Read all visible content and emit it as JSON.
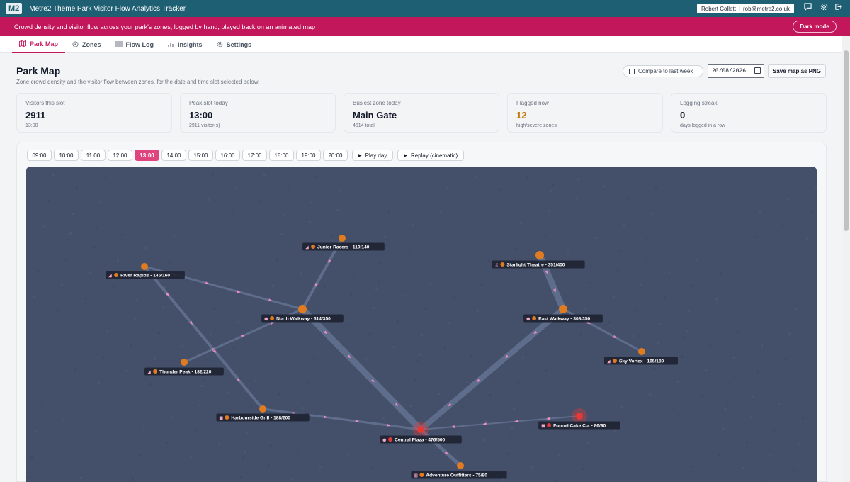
{
  "titlebar": {
    "logo": "M2",
    "title": "Metre2 Theme Park Visitor Flow Analytics Tracker",
    "user_name": "Robert Collett",
    "user_email": "rob@metre2.co.uk"
  },
  "banner": {
    "text": "Crowd density and visitor flow across your park's zones, logged by hand, played back on an animated map",
    "dark_mode_label": "Dark mode"
  },
  "tabs": [
    {
      "label": "Park Map",
      "icon": "map-icon",
      "active": true
    },
    {
      "label": "Zones",
      "icon": "pin-icon",
      "active": false
    },
    {
      "label": "Flow Log",
      "icon": "list-icon",
      "active": false
    },
    {
      "label": "Insights",
      "icon": "bar-chart-icon",
      "active": false
    },
    {
      "label": "Settings",
      "icon": "gear-icon",
      "active": false
    }
  ],
  "header": {
    "title": "Park Map",
    "subtitle": "Zone crowd density and the visitor flow between zones, for the date and time slot selected below.",
    "compare_label": "Compare to last week",
    "date_value": "20/08/2026",
    "save_label": "Save map as PNG"
  },
  "stats": [
    {
      "label": "Visitors this slot",
      "value": "2911",
      "sub": "13:00",
      "warn": false
    },
    {
      "label": "Peak slot today",
      "value": "13:00",
      "sub": "2911 visitor(s)",
      "warn": false
    },
    {
      "label": "Busiest zone today",
      "value": "Main Gate",
      "sub": "4514 total",
      "warn": false
    },
    {
      "label": "Flagged now",
      "value": "12",
      "sub": "high/severe zones",
      "warn": true
    },
    {
      "label": "Logging streak",
      "value": "0",
      "sub": "days logged in a row",
      "warn": false
    }
  ],
  "time_slots": [
    "09:00",
    "10:00",
    "11:00",
    "12:00",
    "13:00",
    "14:00",
    "15:00",
    "16:00",
    "17:00",
    "18:00",
    "19:00",
    "20:00"
  ],
  "selected_slot": "13:00",
  "play_day_label": "Play day",
  "replay_label": "Replay (cinematic)",
  "colors": {
    "accent": "#c2185b",
    "titlebar": "#1f5f73",
    "map_bg": "#44506a",
    "zone_orange": "#e07b1f",
    "zone_red": "#e53935"
  },
  "zones": [
    {
      "name": "Junior Racers",
      "label": "Junior Racers - 119/140",
      "icon": "rides-icon",
      "status": "high"
    },
    {
      "name": "River Rapids",
      "label": "River Rapids - 145/160",
      "icon": "rides-icon",
      "status": "high"
    },
    {
      "name": "Starlight Theatre",
      "label": "Starlight Theatre - 351/400",
      "icon": "show-icon",
      "status": "high"
    },
    {
      "name": "North Walkway",
      "label": "North Walkway - 314/350",
      "icon": "pin-icon",
      "status": "high"
    },
    {
      "name": "East Walkway",
      "label": "East Walkway - 308/350",
      "icon": "pin-icon",
      "status": "high"
    },
    {
      "name": "Sky Vortex",
      "label": "Sky Vortex - 165/180",
      "icon": "rides-icon",
      "status": "high"
    },
    {
      "name": "Thunder Peak",
      "label": "Thunder Peak - 182/220",
      "icon": "rides-icon",
      "status": "high"
    },
    {
      "name": "Harbourside Grill",
      "label": "Harbourside Grill - 188/200",
      "icon": "food-icon",
      "status": "high"
    },
    {
      "name": "Funnel Cake Co.",
      "label": "Funnel Cake Co. - 86/90",
      "icon": "food-icon",
      "status": "severe"
    },
    {
      "name": "Central Plaza",
      "label": "Central Plaza - 476/500",
      "icon": "pin-icon",
      "status": "severe"
    },
    {
      "name": "Adventure Outfitters",
      "label": "Adventure Outfitters - 75/80",
      "icon": "shop-icon",
      "status": "high"
    }
  ]
}
